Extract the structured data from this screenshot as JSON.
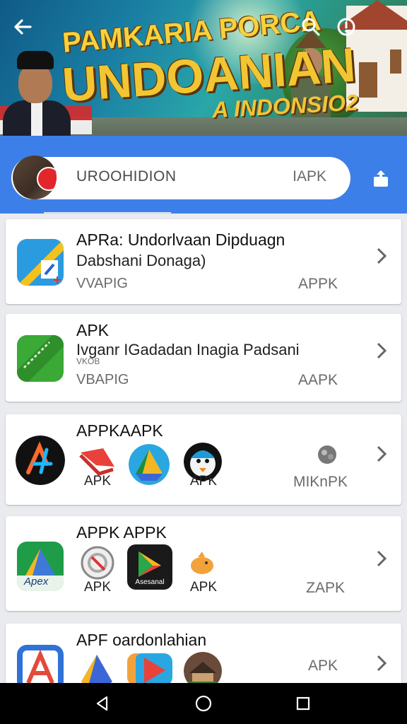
{
  "banner": {
    "title_line1": "PAMKARIA PORCA",
    "title_line2": "UNDOANIAN",
    "title_line3": "A INDONSIO2"
  },
  "search": {
    "query": "UROOHIDION",
    "suffix": "IAPK"
  },
  "cards": [
    {
      "title": "APRa: Undorlvaan Dipduagn",
      "subtitle": "Dabshani Donaga)",
      "meta": "VVAPIG",
      "apk": "APPK"
    },
    {
      "title": "APK",
      "subtitle": "Ivganr IGadadan Inagia Padsani",
      "small": "VKOB",
      "meta": "VBAPIG",
      "apk": "AAPK"
    },
    {
      "title": "APPKAAPK",
      "labels": [
        "APK",
        "APK"
      ],
      "apk": "MIKnPK"
    },
    {
      "title": "APPK APPK",
      "labels": [
        "APK",
        "APK"
      ],
      "icon_text": "Apex",
      "mini_text": "Asesanal",
      "apk": "ZAPK"
    },
    {
      "title": "APF oardonlahian",
      "apk": "APK"
    }
  ],
  "colors": {
    "header_blue": "#3d7fe8",
    "banner_title": "#f2c532",
    "card_bg": "#ffffff",
    "page_bg": "#e9ebee",
    "navbar": "#000000"
  },
  "icons": [
    "back-arrow-icon",
    "search-icon",
    "info-icon",
    "share-icon",
    "chevron-right-icon",
    "nav-back-icon",
    "nav-home-icon",
    "nav-recents-icon"
  ]
}
